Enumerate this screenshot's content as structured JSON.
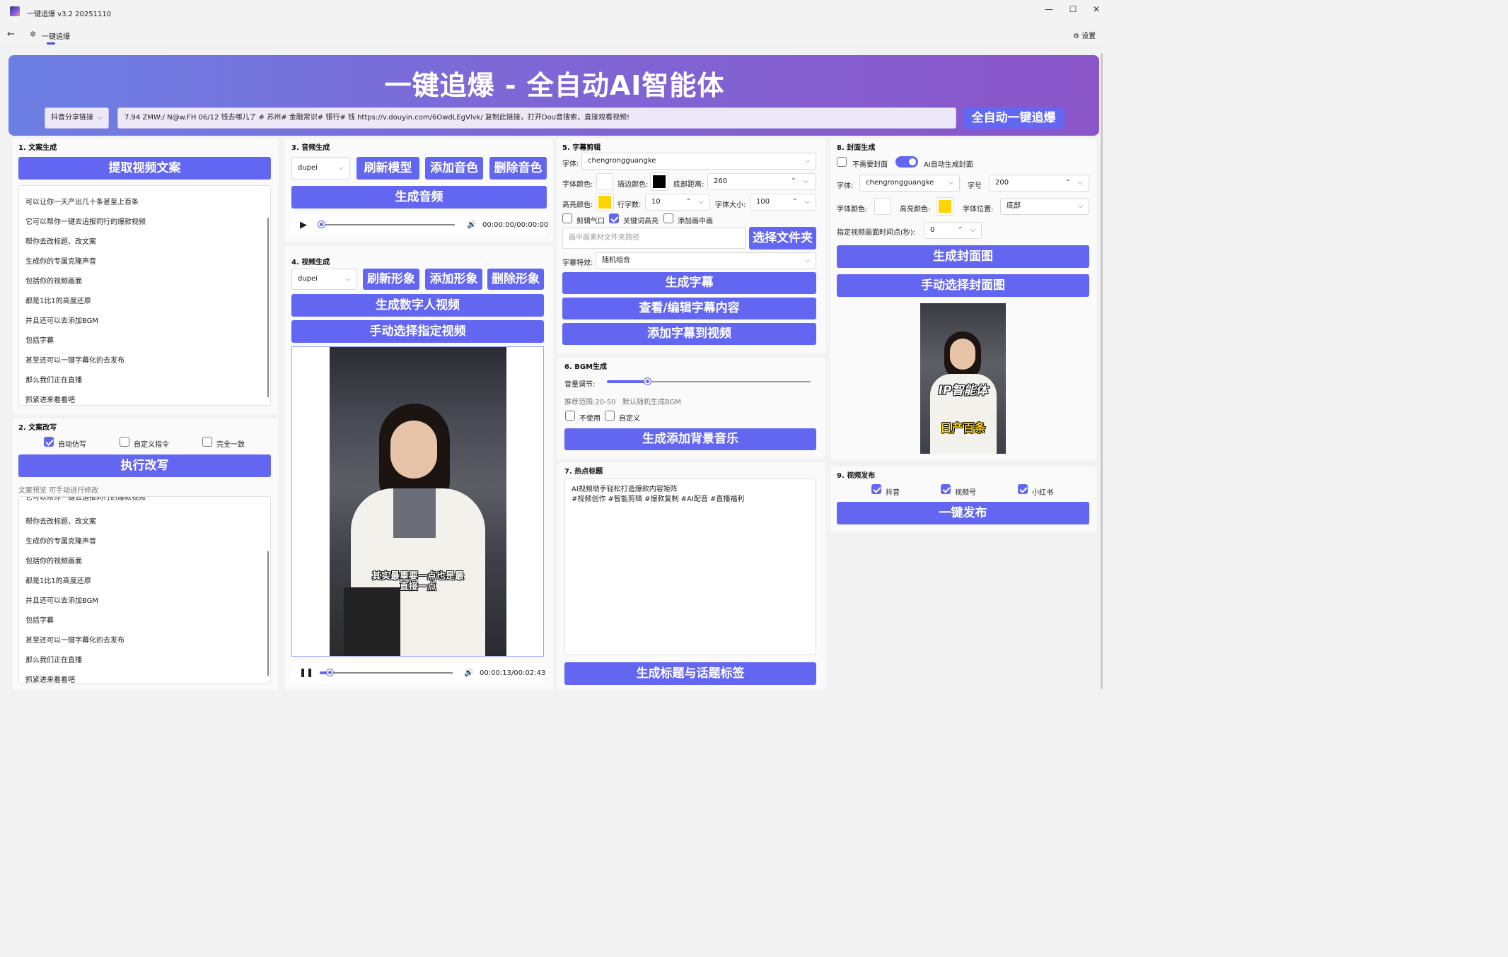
{
  "window": {
    "title": "一键追爆 v3.2 20251110"
  },
  "nav": {
    "tab_label": "一键追爆",
    "settings_label": "设置"
  },
  "hero": {
    "title": "一键追爆 - 全自动AI智能体",
    "source_select": "抖音分享链接",
    "link_value": "7.94 ZMW:/ N@w.FH 06/12 钱去哪儿了 # 苏州# 金融常识# 银行# 钱  https://v.douyin.com/6OwdLEgVlvk/ 复制此链接，打开Dou音搜索，直接观看视频!",
    "run_button": "全自动一键追爆"
  },
  "s1": {
    "title": "1. 文案生成",
    "extract_button": "提取视频文案",
    "lines": [
      "可以让你一天产出几十条甚至上百条",
      "它可以帮你一键去追报同行的爆款视频",
      "帮你去改标题、改文案",
      "生成你的专属克隆声音",
      "包括你的视频画面",
      "都是1比1的高度还原",
      "并且还可以去添加BGM",
      "包括字幕",
      "甚至还可以一键字幕化的去发布",
      "那么我们正在直播",
      "抓紧进来看看吧"
    ]
  },
  "s2": {
    "title": "2. 文案改写",
    "opt_auto": "自动仿写",
    "opt_custom": "自定义指令",
    "opt_same": "完全一致",
    "rewrite_button": "执行改写",
    "preview_hint": "文案预览 可手动进行修改",
    "lines": [
      "它可以帮你一键去追报同行的爆款视频",
      "帮你去改标题、改文案",
      "生成你的专属克隆声音",
      "包括你的视频画面",
      "都是1比1的高度还原",
      "并且还可以去添加BGM",
      "包括字幕",
      "甚至还可以一键字幕化的去发布",
      "那么我们正在直播",
      "抓紧进来看看吧"
    ]
  },
  "s3": {
    "title": "3. 音频生成",
    "voice": "dupei",
    "refresh_button": "刷新模型",
    "add_button": "添加音色",
    "delete_button": "删除音色",
    "gen_button": "生成音频",
    "time": "00:00:00/00:00:00",
    "progress": 0.0
  },
  "s4": {
    "title": "4. 视频生成",
    "avatar": "dupei",
    "refresh_button": "刷新形象",
    "add_button": "添加形象",
    "delete_button": "删除形象",
    "gen_button": "生成数字人视频",
    "manual_button": "手动选择指定视频",
    "subtitle": "其实最重要一点也是最\n直接一点",
    "time": "00:00:13/00:02:43",
    "progress": 0.08
  },
  "s5": {
    "title": "5. 字幕剪辑",
    "font_label": "字体:",
    "font_value": "chengrongguangke",
    "color_label": "字体颜色:",
    "stroke_label": "描边颜色:",
    "bottom_label": "底部距离:",
    "bottom_value": "260",
    "highlight_label": "高亮颜色:",
    "lines_label": "行字数:",
    "lines_value": "10",
    "size_label": "字体大小:",
    "size_value": "100",
    "opt_cut": "剪辑气口",
    "opt_keyword": "关键词高亮",
    "opt_pip": "添加画中画",
    "folder_placeholder": "画中画素材文件夹路径",
    "folder_button": "选择文件夹",
    "effect_label": "字幕特效:",
    "effect_value": "随机组合",
    "gen_button": "生成字幕",
    "edit_button": "查看/编辑字幕内容",
    "add_button": "添加字幕到视频",
    "colors": {
      "font": "#ffffff",
      "stroke": "#000000",
      "highlight": "#ffd400"
    }
  },
  "s6": {
    "title": "6. BGM生成",
    "volume_label": "音量调节:",
    "volume": 0.2,
    "hint": "推荐范围:20-50   默认随机生成BGM",
    "opt_none": "不使用",
    "opt_custom": "自定义",
    "gen_button": "生成添加背景音乐"
  },
  "s7": {
    "title": "7. 热点标题",
    "content_line1": "AI视频助手轻松打造爆款内容矩阵",
    "content_line2": "#视频创作 #智能剪辑 #爆款复制 #AI配音 #直播福利",
    "gen_button": "生成标题与话题标签"
  },
  "s8": {
    "title": "8. 封面生成",
    "opt_none": "不需要封面",
    "opt_ai": "AI自动生成封面",
    "font_label": "字体:",
    "font_value": "chengrongguangke",
    "size_label": "字号",
    "size_value": "200",
    "color_label": "字体颜色:",
    "highlight_label": "高亮颜色:",
    "pos_label": "字体位置:",
    "pos_value": "底部",
    "time_label": "指定视频画面时间点(秒):",
    "time_value": "0",
    "gen_button": "生成封面图",
    "manual_button": "手动选择封面图",
    "cover_title": "IP智能体",
    "cover_sub": "日产百条",
    "colors": {
      "font": "#ffffff",
      "highlight": "#ffd400"
    }
  },
  "s9": {
    "title": "9. 视频发布",
    "opt_douyin": "抖音",
    "opt_channels": "视频号",
    "opt_xhs": "小红书",
    "publish_button": "一键发布"
  }
}
